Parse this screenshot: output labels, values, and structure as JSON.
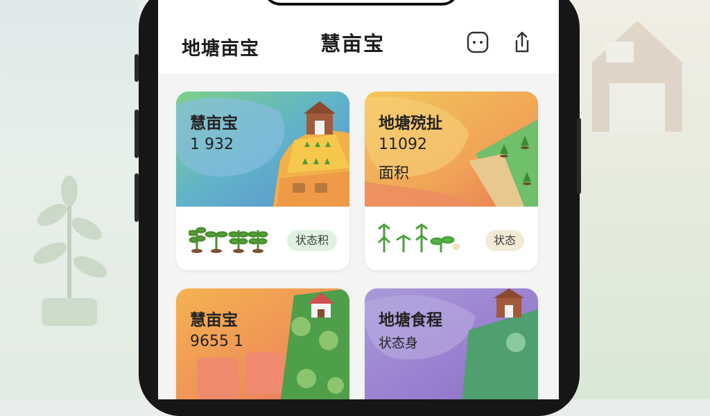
{
  "header": {
    "left_title": "地塘亩宝",
    "center_title": "慧亩宝",
    "icons": [
      "smile-box-icon",
      "share-icon"
    ]
  },
  "cards": [
    {
      "title": "慧亩宝",
      "value": "1 932",
      "subtitle": "",
      "badge": "状态积",
      "badge_color": "#dff2e0"
    },
    {
      "title": "地塘殑扯",
      "value": "11092",
      "subtitle": "面积",
      "badge": "状态",
      "badge_color": "#f3ead6"
    },
    {
      "title": "慧亩宝",
      "value": "9655 1",
      "subtitle": "",
      "badge": "",
      "badge_color": ""
    },
    {
      "title": "地塘食程",
      "value": "",
      "subtitle": "状态身",
      "badge": "",
      "badge_color": ""
    }
  ],
  "colors": {
    "accent_green": "#5f9a4d",
    "header_bg": "#ffffff",
    "page_bg": "#f4f4f4"
  }
}
